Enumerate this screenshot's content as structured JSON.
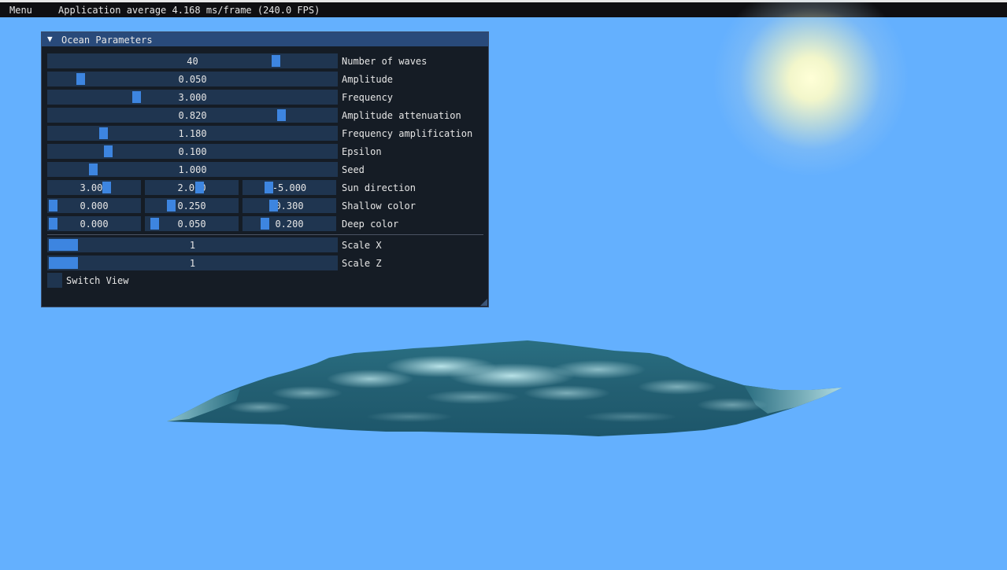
{
  "menubar": {
    "menu_label": "Menu",
    "fps_text": "Application average 4.168 ms/frame (240.0 FPS)"
  },
  "panel": {
    "collapse_arrow": "▼",
    "title": "Ocean Parameters",
    "rows": {
      "num_waves": {
        "label": "Number of waves",
        "value": "40"
      },
      "amplitude": {
        "label": "Amplitude",
        "value": "0.050"
      },
      "frequency": {
        "label": "Frequency",
        "value": "3.000"
      },
      "amp_atten": {
        "label": "Amplitude attenuation",
        "value": "0.820"
      },
      "freq_amp": {
        "label": "Frequency amplification",
        "value": "1.180"
      },
      "epsilon": {
        "label": "Epsilon",
        "value": "0.100"
      },
      "seed": {
        "label": "Seed",
        "value": "1.000"
      },
      "sun_dir": {
        "label": "Sun direction",
        "values": [
          "3.000",
          "2.000",
          "-5.000"
        ]
      },
      "shallow": {
        "label": "Shallow color",
        "values": [
          "0.000",
          "0.250",
          "0.300"
        ]
      },
      "deep": {
        "label": "Deep color",
        "values": [
          "0.000",
          "0.050",
          "0.200"
        ]
      },
      "scale_x": {
        "label": "Scale X",
        "value": "1"
      },
      "scale_z": {
        "label": "Scale Z",
        "value": "1"
      }
    },
    "switch_view_label": "Switch View",
    "switch_view_checked": false
  },
  "colors": {
    "sky": "#64b0fe",
    "panel_bg": "#12161c",
    "title_bar": "#294a7a",
    "slider_bg": "#1f3550",
    "slider_grab": "#3d85e0",
    "ocean_deep": "#1e5a6e",
    "ocean_shallow": "#a8e0ea"
  }
}
